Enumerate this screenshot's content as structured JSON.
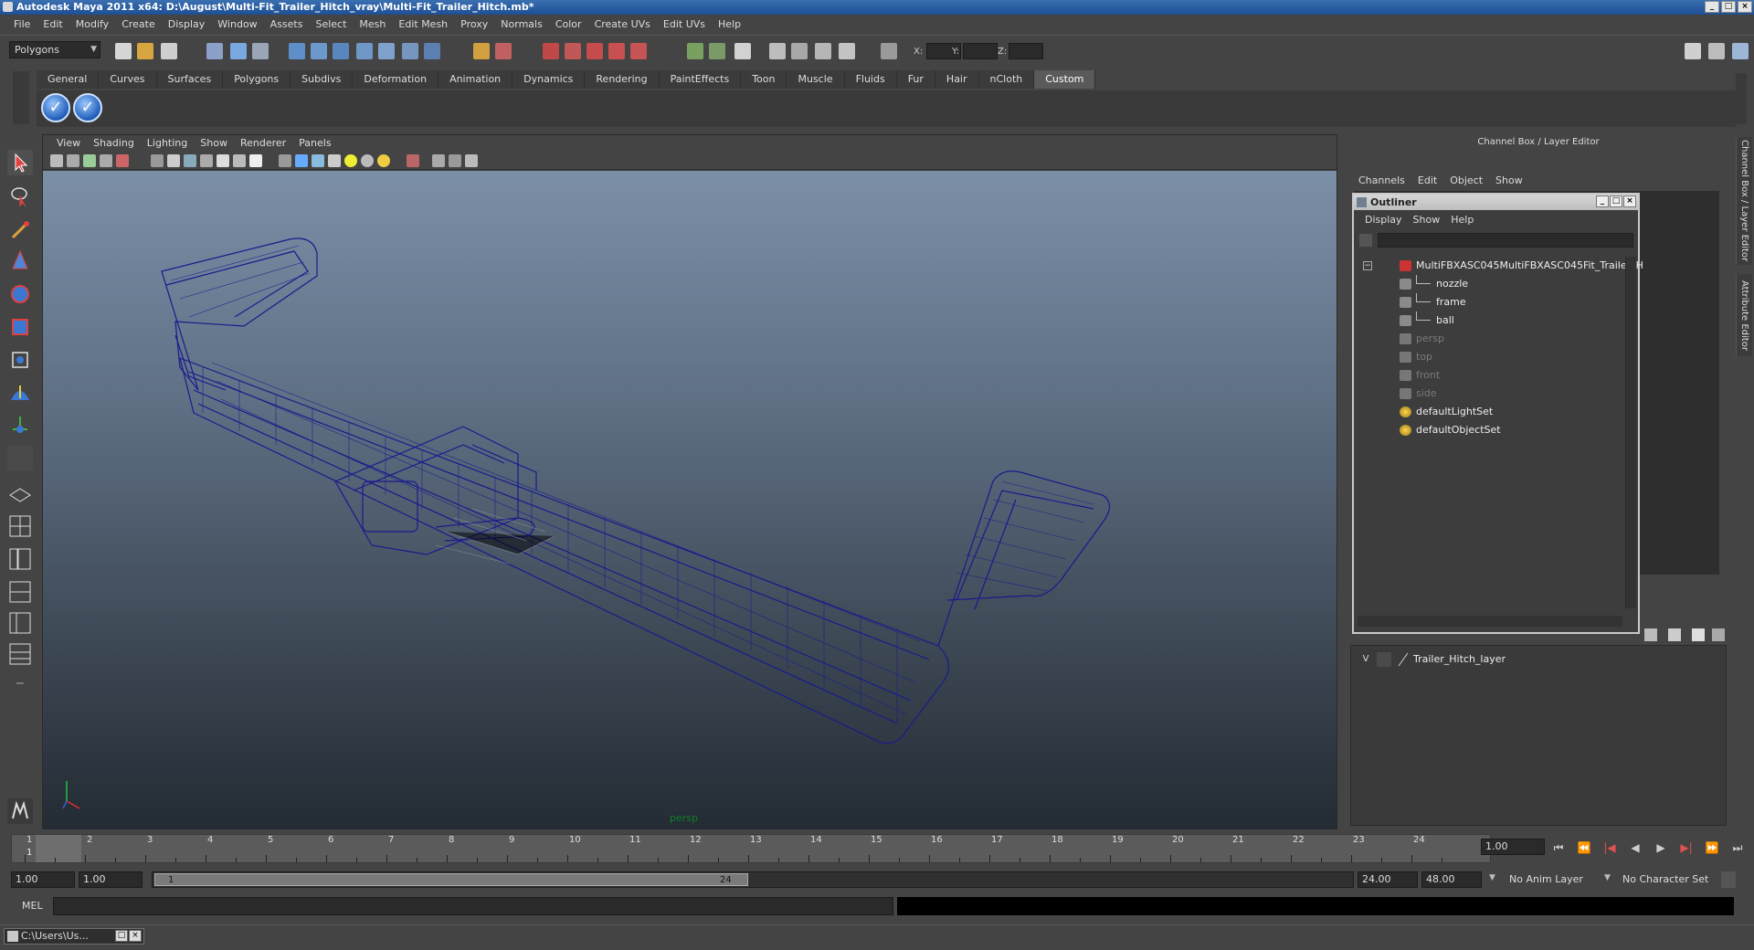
{
  "window": {
    "title": "Autodesk Maya 2011 x64: D:\\August\\Multi-Fit_Trailer_Hitch_vray\\Multi-Fit_Trailer_Hitch.mb*",
    "minimize": "_",
    "maximize": "□",
    "close": "×"
  },
  "menubar": [
    "File",
    "Edit",
    "Modify",
    "Create",
    "Display",
    "Window",
    "Assets",
    "Select",
    "Mesh",
    "Edit Mesh",
    "Proxy",
    "Normals",
    "Color",
    "Create UVs",
    "Edit UVs",
    "Help"
  ],
  "statusline": {
    "mode": "Polygons",
    "x_label": "X:",
    "y_label": "Y:",
    "z_label": "Z:"
  },
  "shelf": {
    "tabs": [
      "General",
      "Curves",
      "Surfaces",
      "Polygons",
      "Subdivs",
      "Deformation",
      "Animation",
      "Dynamics",
      "Rendering",
      "PaintEffects",
      "Toon",
      "Muscle",
      "Fluids",
      "Fur",
      "Hair",
      "nCloth",
      "Custom"
    ],
    "active_tab": "Custom",
    "buttons": [
      "checkmark-icon",
      "checkmark-icon"
    ]
  },
  "viewport": {
    "menu": [
      "View",
      "Shading",
      "Lighting",
      "Show",
      "Renderer",
      "Panels"
    ],
    "camera": "persp",
    "wire_color": "#1a1a8c"
  },
  "channel_box": {
    "title": "Channel Box / Layer Editor",
    "menu": [
      "Channels",
      "Edit",
      "Object",
      "Show"
    ]
  },
  "outliner": {
    "title": "Outliner",
    "menu": [
      "Display",
      "Show",
      "Help"
    ],
    "items": [
      {
        "label": "MultiFBXASC045MultiFBXASC045Fit_Trailer_H",
        "kind": "group",
        "dim": false
      },
      {
        "label": "nozzle",
        "kind": "mesh",
        "dim": false
      },
      {
        "label": "frame",
        "kind": "mesh",
        "dim": false
      },
      {
        "label": "ball",
        "kind": "mesh",
        "dim": false
      },
      {
        "label": "persp",
        "kind": "camera",
        "dim": true
      },
      {
        "label": "top",
        "kind": "camera",
        "dim": true
      },
      {
        "label": "front",
        "kind": "camera",
        "dim": true
      },
      {
        "label": "side",
        "kind": "camera",
        "dim": true
      },
      {
        "label": "defaultLightSet",
        "kind": "set",
        "dim": false
      },
      {
        "label": "defaultObjectSet",
        "kind": "set",
        "dim": false
      }
    ]
  },
  "layer_editor": {
    "layers": [
      {
        "visible": "V",
        "name": "Trailer_Hitch_layer"
      }
    ]
  },
  "side_tabs": [
    "Channel Box / Layer Editor",
    "Attribute Editor"
  ],
  "timeline": {
    "ticks": [
      "1",
      "2",
      "3",
      "4",
      "5",
      "6",
      "7",
      "8",
      "9",
      "10",
      "11",
      "12",
      "13",
      "14",
      "15",
      "16",
      "17",
      "18",
      "19",
      "20",
      "21",
      "22",
      "23",
      "24"
    ],
    "current_frame_label": "1",
    "current_frame_field": "1.00",
    "playback": [
      "⏮",
      "⏪",
      "|◀",
      "◀",
      "▶",
      "▶|",
      "⏩",
      "⏭"
    ]
  },
  "range": {
    "start": "1.00",
    "playback_start": "1.00",
    "thumb_start": "1",
    "thumb_end": "24",
    "playback_end": "24.00",
    "end": "48.00",
    "anim_layer": "No Anim Layer",
    "character_set": "No Character Set"
  },
  "command_line": {
    "label": "MEL"
  },
  "taskbar": {
    "item": "C:\\Users\\Us..."
  }
}
